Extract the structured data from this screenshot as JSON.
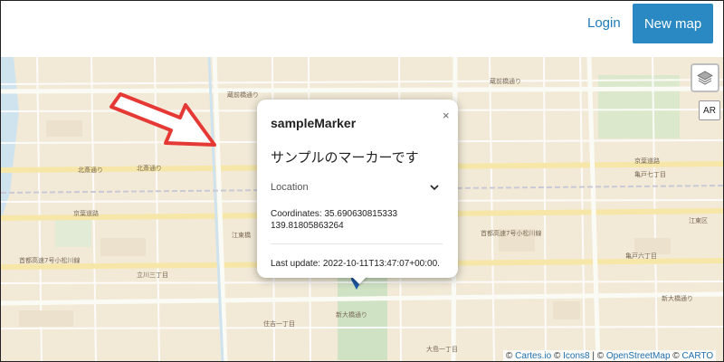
{
  "header": {
    "login_label": "Login",
    "new_map_label": "New map"
  },
  "controls": {
    "layers_icon": "layers-icon",
    "ar_label": "AR"
  },
  "popup": {
    "title": "sampleMarker",
    "description": "サンプルのマーカーです",
    "location_label": "Location",
    "coordinates_line1": "Coordinates: 35.690630815333",
    "coordinates_line2": "139.81805863264",
    "last_update": "Last update: 2022-10-11T13:47:07+00:00.",
    "close_symbol": "×"
  },
  "attribution": {
    "copyright1": "©",
    "cartes": "Cartes.io",
    "copyright2": "©",
    "icons8": "Icons8",
    "sep": "|",
    "copyright3": "©",
    "osm": "OpenStreetMap",
    "copyright4": "©",
    "carto": "CARTO"
  },
  "map_labels": [
    "錦糸町通り",
    "蔵前橋通り",
    "京葉道路",
    "首都高速7号小松川線",
    "北斎通り",
    "江東橋",
    "住吉一丁目",
    "新大橋通り",
    "亀戸七丁目",
    "亀戸六丁目",
    "大島一丁目",
    "立川三丁目",
    "京葉道路",
    "北斎通り",
    "江東区"
  ],
  "colors": {
    "accent": "#2a88c2",
    "link": "#1f7bb6",
    "map_bg": "#f2ead7",
    "arrow": "#e53935"
  }
}
